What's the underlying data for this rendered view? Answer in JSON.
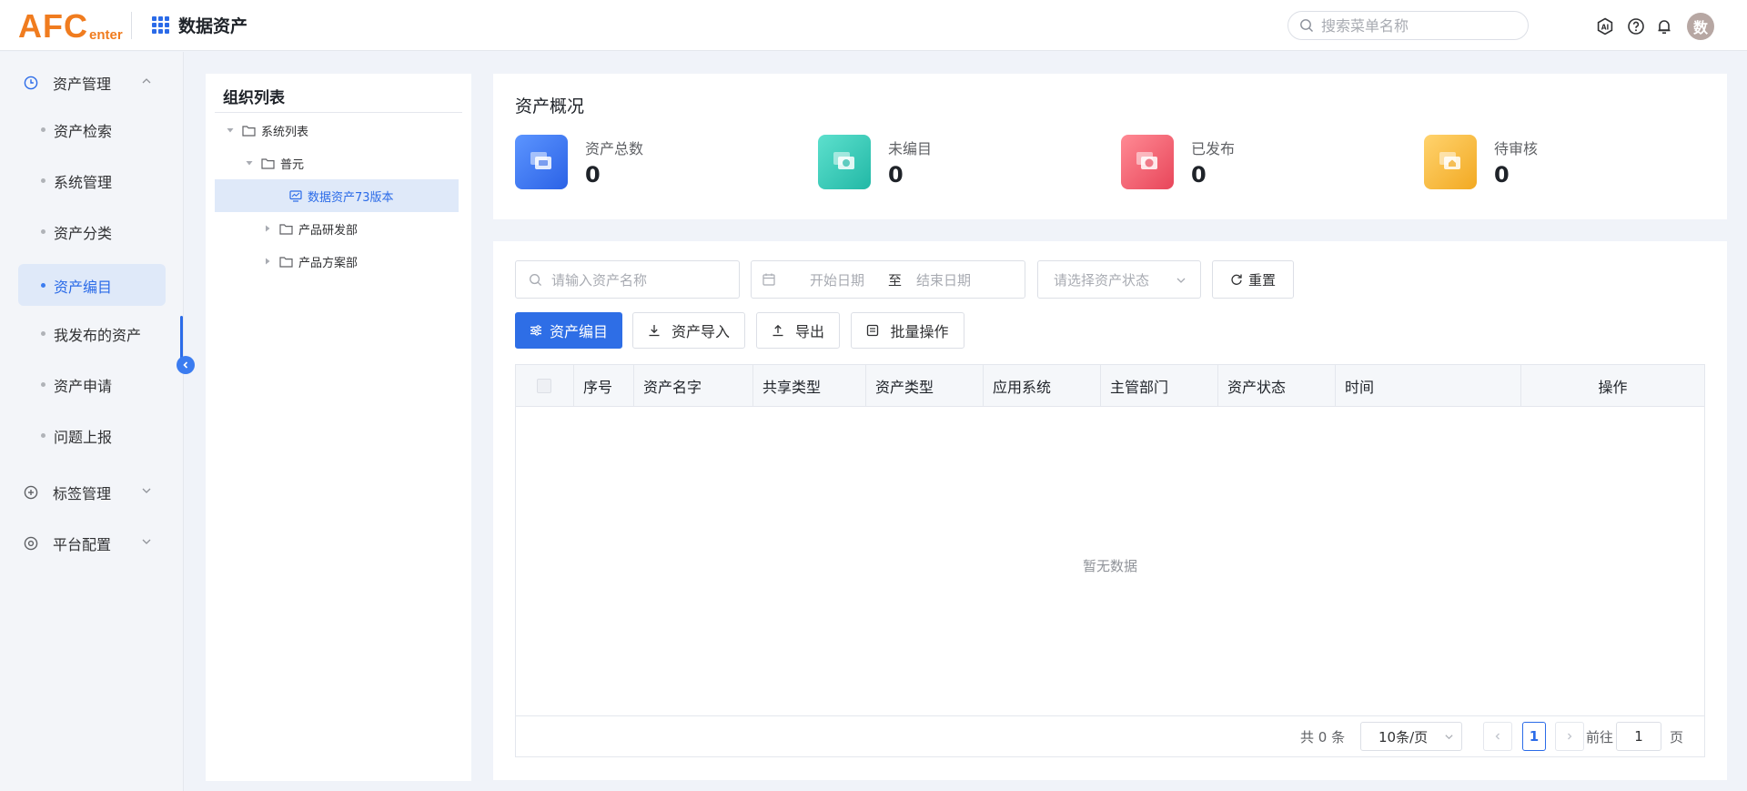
{
  "header": {
    "logo_main": "AFC",
    "logo_sub": "enter",
    "app_title": "数据资产",
    "search_placeholder": "搜索菜单名称",
    "avatar_text": "数",
    "icons": [
      "ai-icon",
      "help-icon",
      "bell-icon"
    ]
  },
  "sidebar": {
    "groups": [
      {
        "label": "资产管理",
        "icon": "clock-icon",
        "expanded": true
      },
      {
        "label": "标签管理",
        "icon": "plus-circle-icon",
        "expanded": false
      },
      {
        "label": "平台配置",
        "icon": "gear-icon",
        "expanded": false
      }
    ],
    "items": [
      {
        "label": "资产检索"
      },
      {
        "label": "系统管理"
      },
      {
        "label": "资产分类"
      },
      {
        "label": "资产编目",
        "active": true
      },
      {
        "label": "我发布的资产"
      },
      {
        "label": "资产申请"
      },
      {
        "label": "问题上报"
      }
    ],
    "accent": "#2b6be8"
  },
  "tree": {
    "title": "组织列表",
    "nodes": [
      {
        "label": "系统列表"
      },
      {
        "label": "普元"
      },
      {
        "label": "数据资产73版本",
        "selected": true
      },
      {
        "label": "产品研发部"
      },
      {
        "label": "产品方案部"
      }
    ]
  },
  "overview": {
    "title": "资产概况",
    "stats": [
      {
        "label": "资产总数",
        "value": "0",
        "color": "#2f6ff0"
      },
      {
        "label": "未编目",
        "value": "0",
        "color": "#2dc6b4"
      },
      {
        "label": "已发布",
        "value": "0",
        "color": "#ee5d6a"
      },
      {
        "label": "待审核",
        "value": "0",
        "color": "#f6b83c"
      }
    ]
  },
  "filters": {
    "name_placeholder": "请输入资产名称",
    "start_date_placeholder": "开始日期",
    "range_separator": "至",
    "end_date_placeholder": "结束日期",
    "status_placeholder": "请选择资产状态",
    "reset_label": "重置"
  },
  "actions": {
    "catalog_label": "资产编目",
    "import_label": "资产导入",
    "export_label": "导出",
    "batch_label": "批量操作"
  },
  "table": {
    "columns": [
      "序号",
      "资产名字",
      "共享类型",
      "资产类型",
      "应用系统",
      "主管部门",
      "资产状态",
      "时间",
      "操作"
    ],
    "empty_text": "暂无数据"
  },
  "pagination": {
    "total_text": "共 0 条",
    "page_size": "10条/页",
    "current_page": "1",
    "goto_prefix": "前往",
    "goto_value": "1",
    "goto_suffix": "页"
  }
}
